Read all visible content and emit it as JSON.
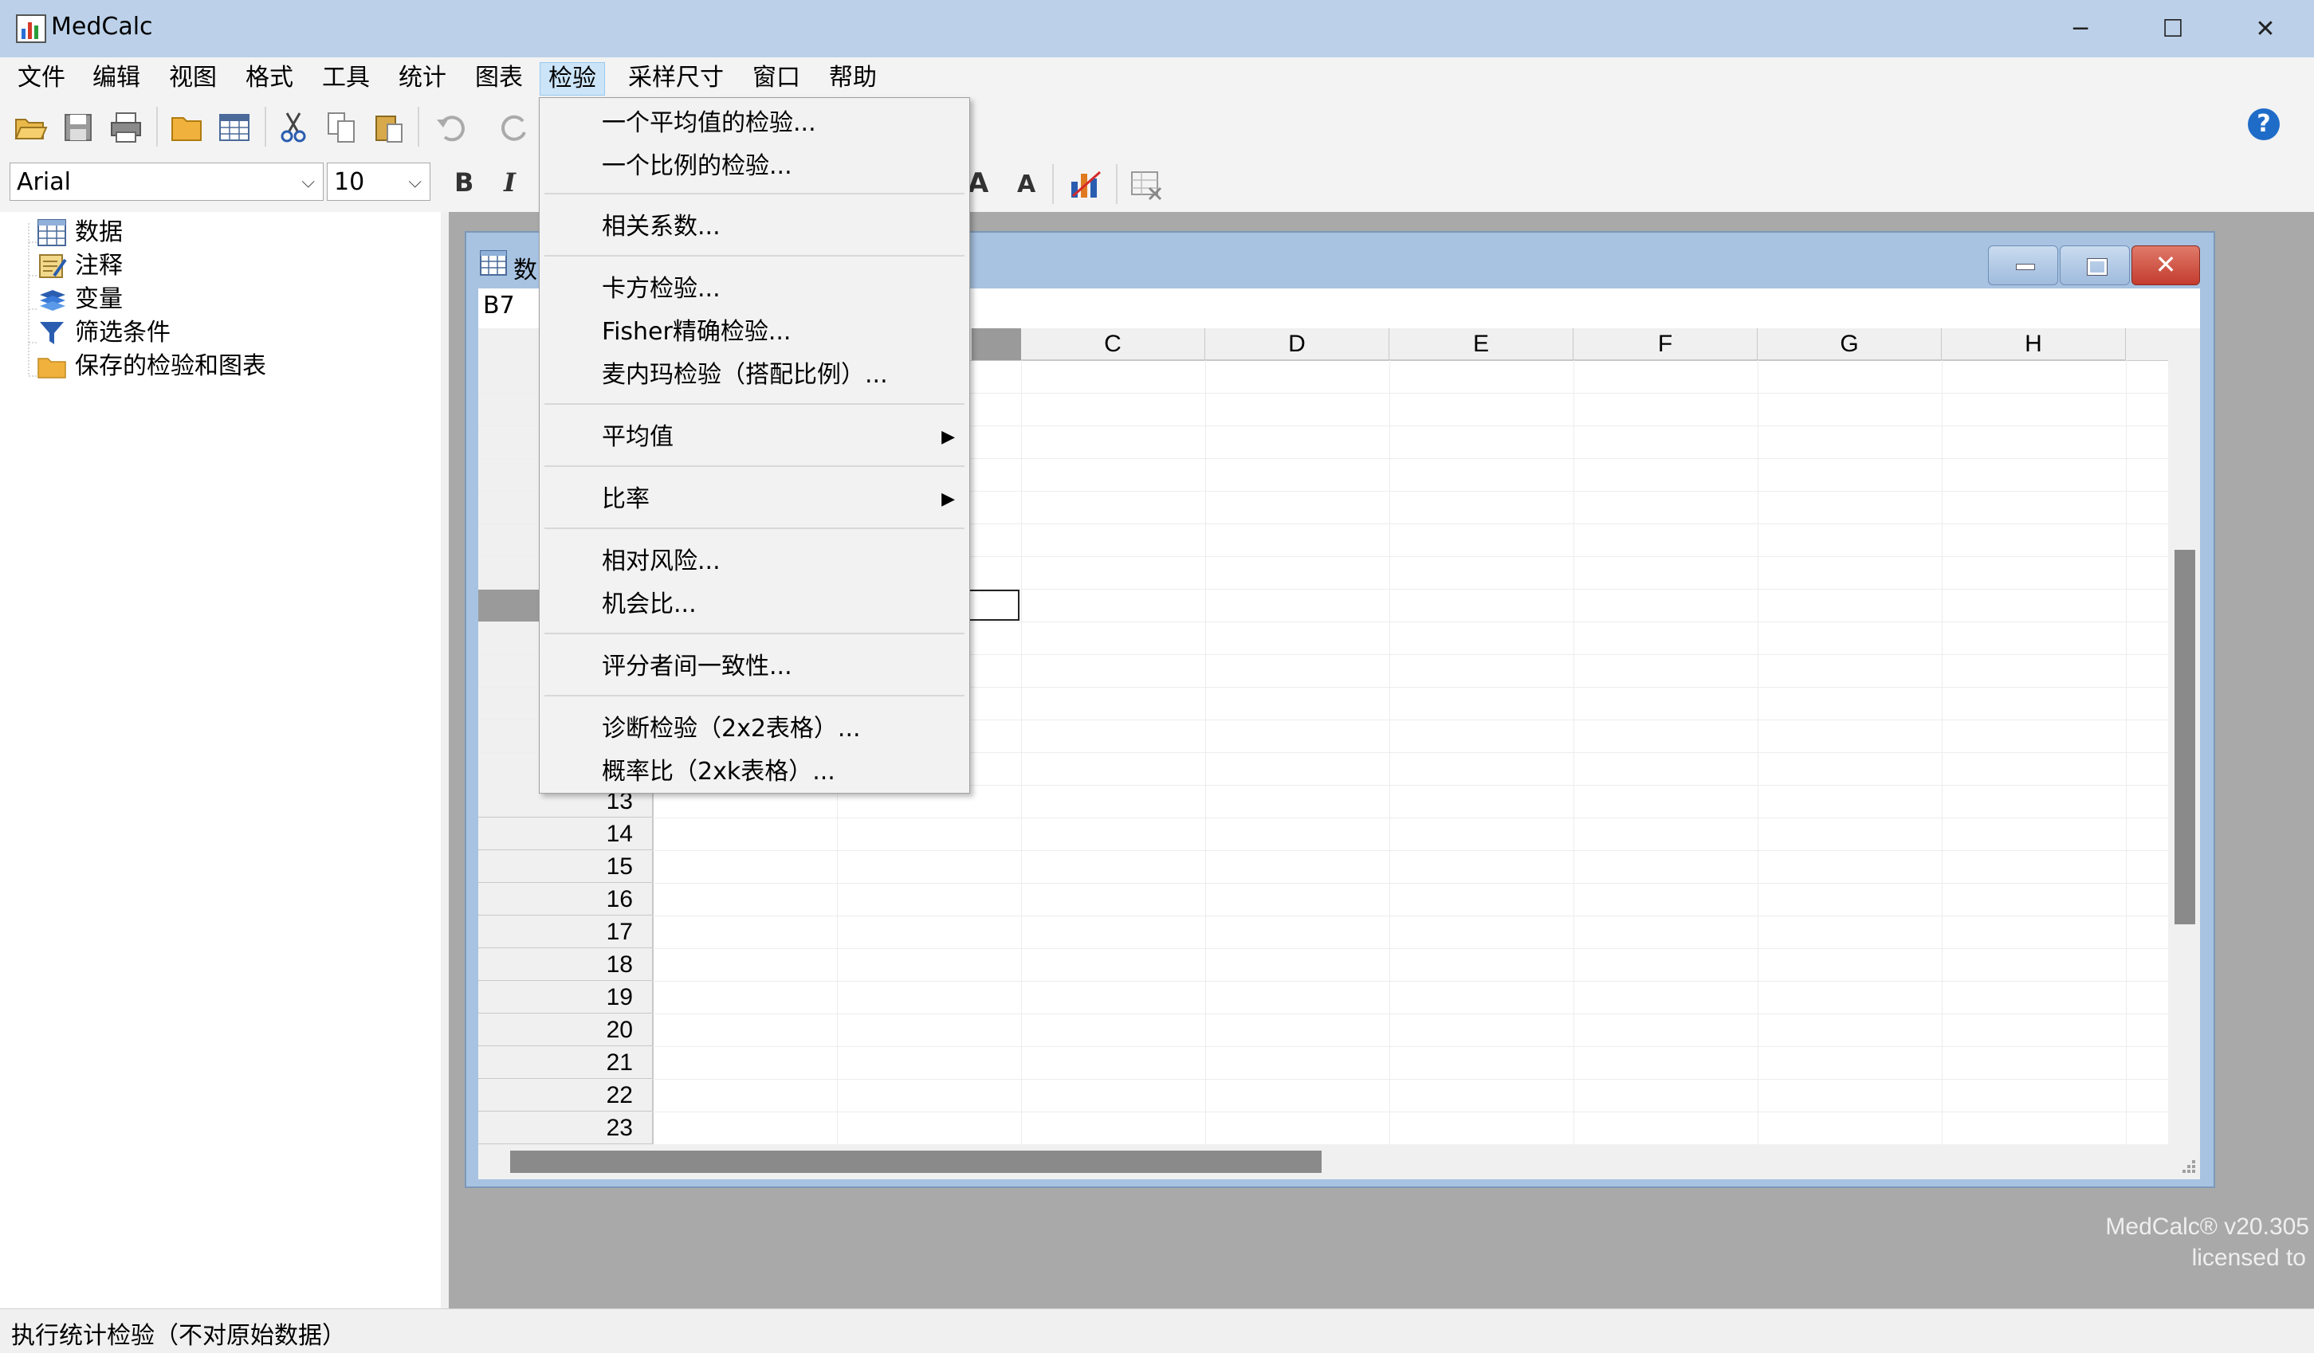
{
  "app": {
    "title": "MedCalc",
    "window_controls": {
      "minimize": "─",
      "maximize": "☐",
      "close": "✕"
    }
  },
  "menubar": {
    "items": [
      "文件",
      "编辑",
      "视图",
      "格式",
      "工具",
      "统计",
      "图表",
      "检验",
      "采样尺寸",
      "窗口",
      "帮助"
    ],
    "active_item": "检验"
  },
  "toolbar": {
    "font_name": "Arial",
    "font_size": "10",
    "bold_label": "B",
    "italic_label": "I",
    "grow_font_label": "A",
    "shrink_font_label": "A",
    "help_label": "?"
  },
  "tree": {
    "items": [
      {
        "label": "数据",
        "icon": "spreadsheet-icon"
      },
      {
        "label": "注释",
        "icon": "notes-icon"
      },
      {
        "label": "变量",
        "icon": "variables-icon"
      },
      {
        "label": "筛选条件",
        "icon": "filter-icon"
      },
      {
        "label": "保存的检验和图表",
        "icon": "folder-icon"
      }
    ]
  },
  "data_window": {
    "title": "数",
    "cell_reference": "B7",
    "selected_cell": "B7",
    "columns": [
      "C",
      "D",
      "E",
      "F",
      "G",
      "H"
    ],
    "row_numbers": [
      "13",
      "14",
      "15",
      "16",
      "17",
      "18",
      "19",
      "20",
      "21",
      "22",
      "23"
    ]
  },
  "dropdown_menu": {
    "items": [
      {
        "label": "一个平均值的检验...",
        "submenu": false
      },
      {
        "label": "一个比例的检验...",
        "submenu": false
      },
      {
        "separator": true
      },
      {
        "label": "相关系数...",
        "submenu": false
      },
      {
        "separator": true
      },
      {
        "label": "卡方检验...",
        "submenu": false
      },
      {
        "label": "Fisher精确检验...",
        "submenu": false
      },
      {
        "label": "麦内玛检验（搭配比例）...",
        "submenu": false
      },
      {
        "separator": true
      },
      {
        "label": "平均值",
        "submenu": true
      },
      {
        "separator": true
      },
      {
        "label": "比率",
        "submenu": true
      },
      {
        "separator": true
      },
      {
        "label": "相对风险...",
        "submenu": false
      },
      {
        "label": "机会比...",
        "submenu": false
      },
      {
        "separator": true
      },
      {
        "label": "评分者间一致性...",
        "submenu": false
      },
      {
        "separator": true
      },
      {
        "label": "诊断检验（2x2表格）...",
        "submenu": false
      },
      {
        "label": "概率比（2xk表格）...",
        "submenu": false
      }
    ],
    "submenu_arrow": "▶"
  },
  "watermark": {
    "line1": "MedCalc® v20.305",
    "line2": "licensed to"
  },
  "status_bar": {
    "text": "执行统计检验（不对原始数据）"
  },
  "colors": {
    "title_bar": "#bcd1e9",
    "mdi_background": "#a9a9a9",
    "close_button": "#c93a32",
    "menu_highlight": "#cce4f7"
  }
}
